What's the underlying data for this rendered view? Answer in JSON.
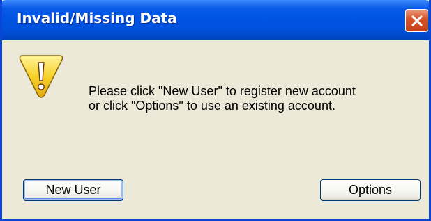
{
  "window": {
    "title": "Invalid/Missing Data"
  },
  "icons": {
    "warning": "warning-icon",
    "close": "close-icon"
  },
  "message": {
    "line1": "Please click \"New User\" to register new account",
    "line2": "or click \"Options\" to use an existing account."
  },
  "buttons": {
    "new_user": {
      "label_pre": "N",
      "label_mnemonic": "e",
      "label_post": "w User"
    },
    "options": {
      "label": "Options"
    }
  },
  "colors": {
    "titlebar": "#0054e3",
    "frame": "#0a46d6",
    "dialog_bg": "#ece9d8",
    "close_button": "#d9552b",
    "warning_fill": "#f7d22a"
  }
}
